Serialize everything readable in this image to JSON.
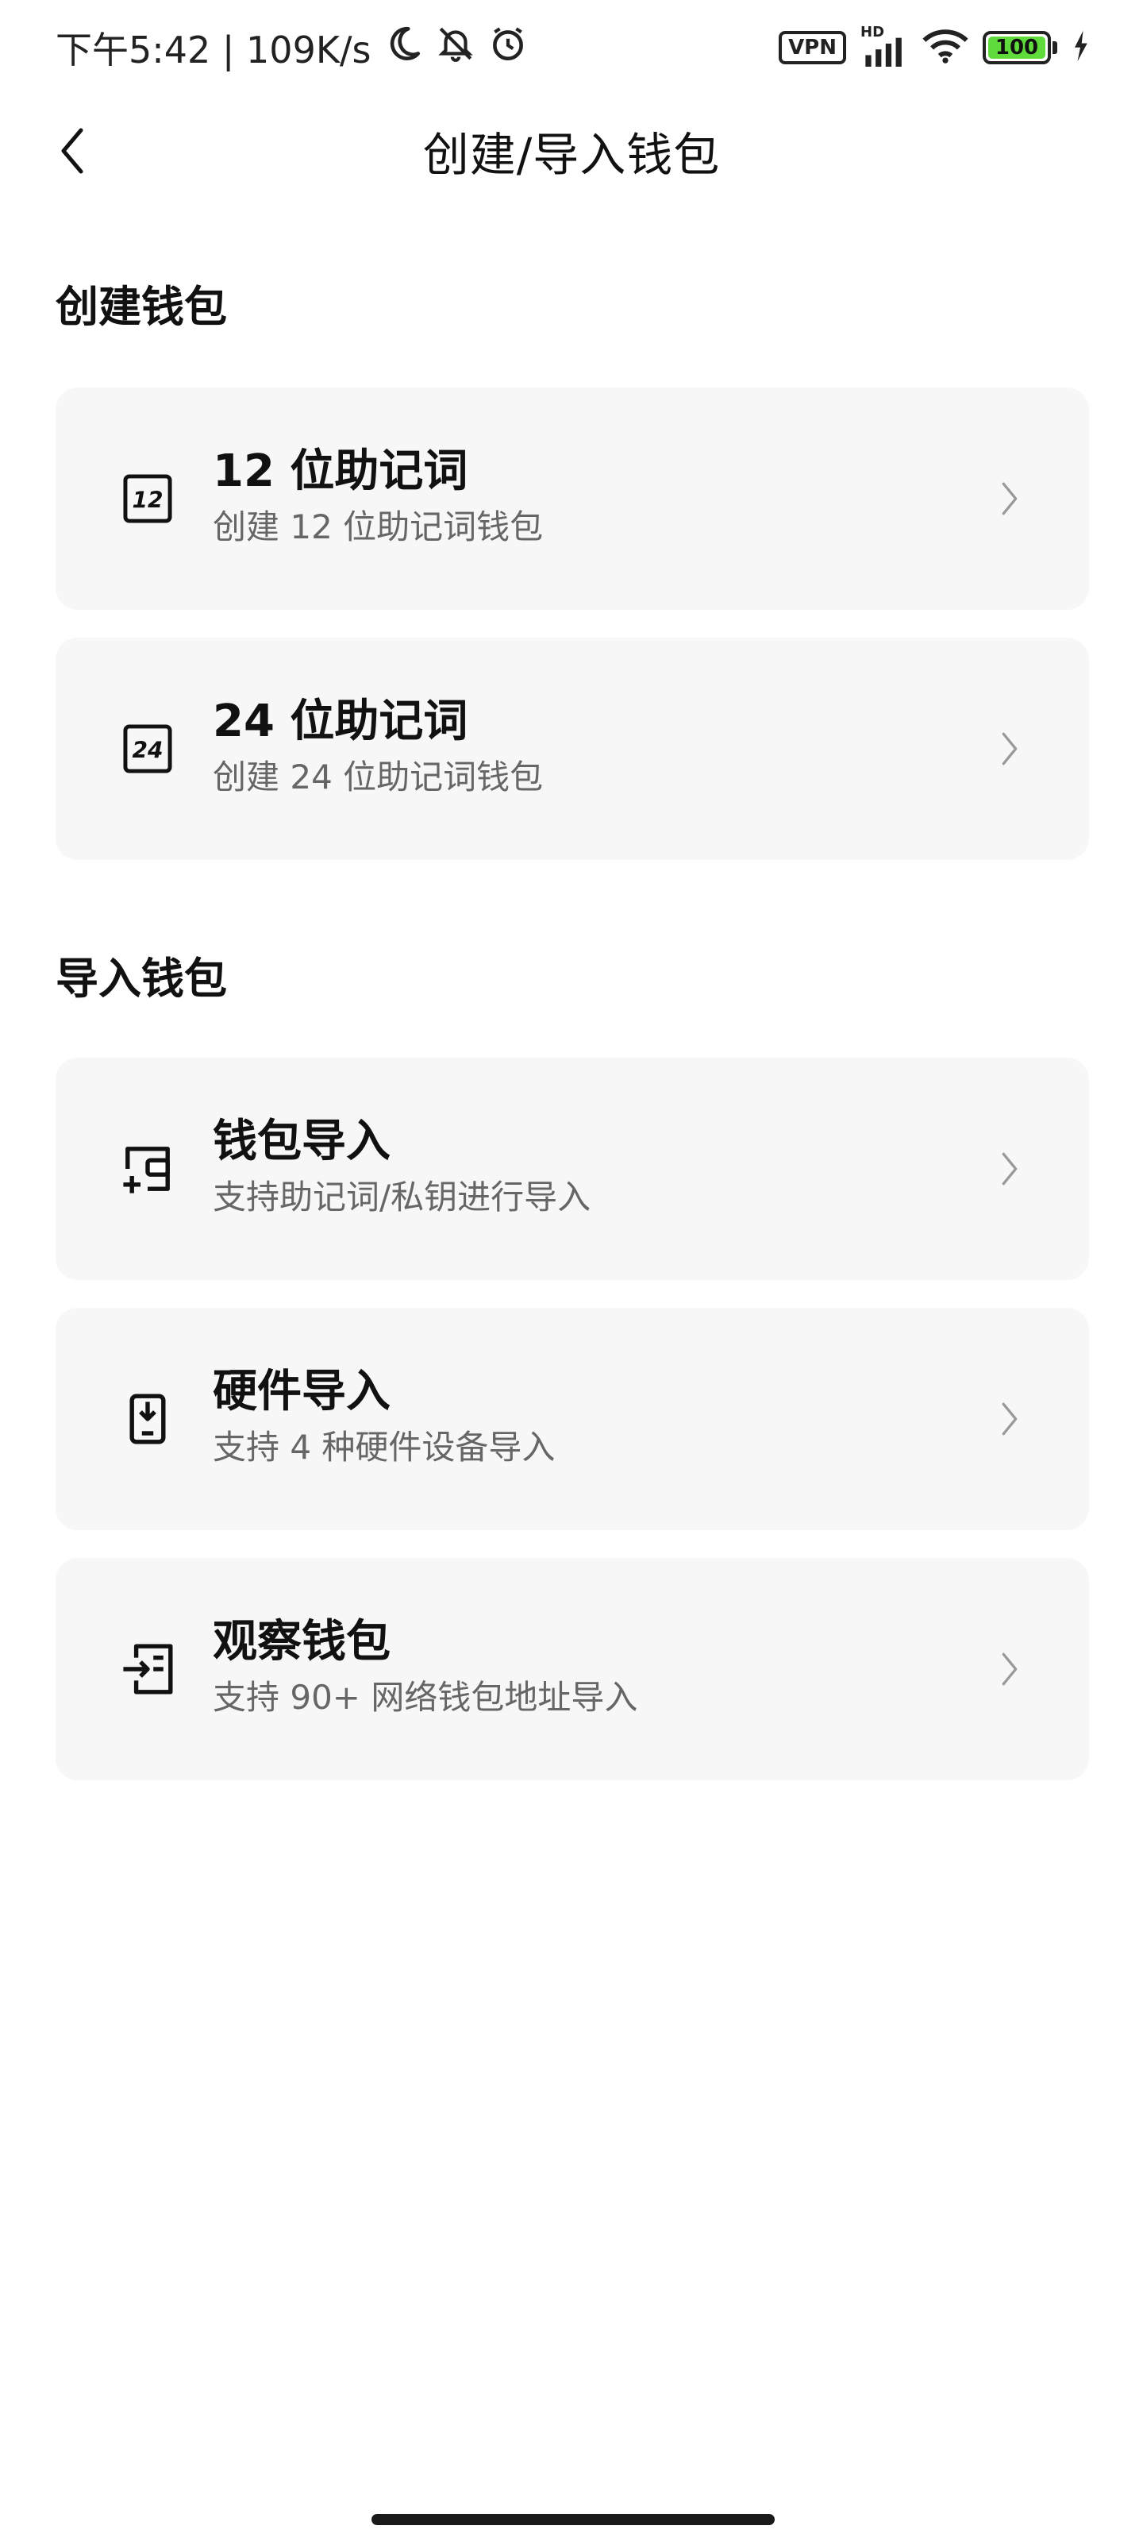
{
  "status_bar": {
    "time_speed": "下午5:42 | 109K/s",
    "vpn": "VPN",
    "hd": "HD",
    "battery": "100"
  },
  "header": {
    "title": "创建/导入钱包"
  },
  "create_section": {
    "title": "创建钱包",
    "items": [
      {
        "icon_text": "12",
        "title": "12 位助记词",
        "subtitle": "创建 12 位助记词钱包"
      },
      {
        "icon_text": "24",
        "title": "24 位助记词",
        "subtitle": "创建 24 位助记词钱包"
      }
    ]
  },
  "import_section": {
    "title": "导入钱包",
    "items": [
      {
        "icon": "wallet-import-icon",
        "title": "钱包导入",
        "subtitle": "支持助记词/私钥进行导入"
      },
      {
        "icon": "hardware-device-icon",
        "title": "硬件导入",
        "subtitle": "支持 4 种硬件设备导入"
      },
      {
        "icon": "watch-wallet-icon",
        "title": "观察钱包",
        "subtitle": "支持 90+ 网络钱包地址导入"
      }
    ]
  },
  "colors": {
    "card_bg": "#f7f7f7",
    "battery_fill": "#5fdc3c",
    "subtitle": "#666666"
  }
}
